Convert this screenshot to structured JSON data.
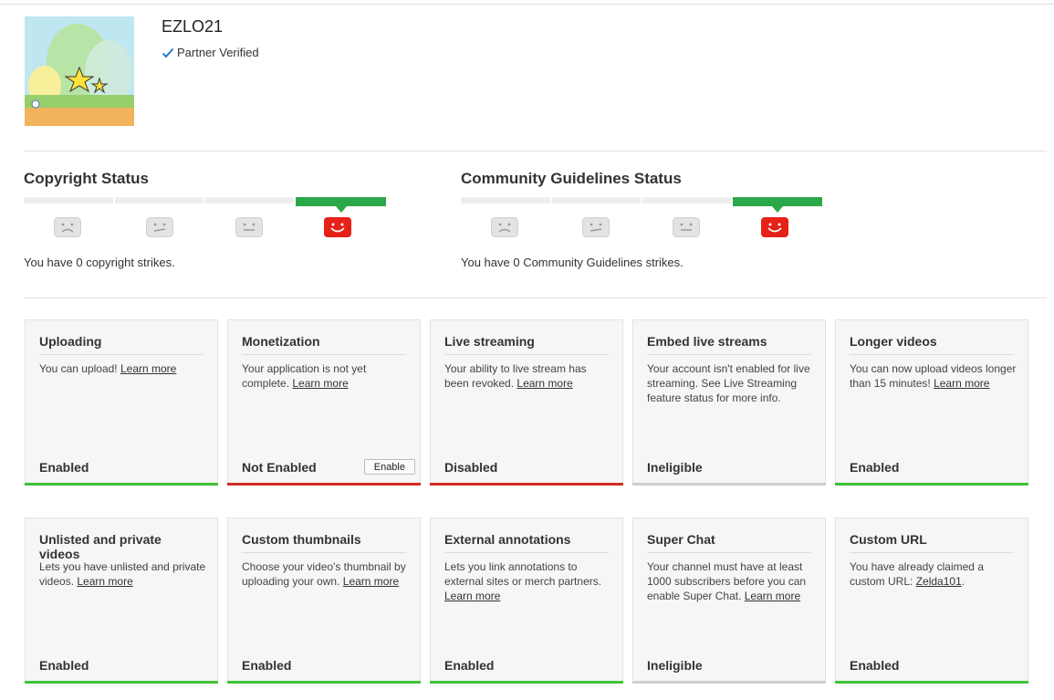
{
  "channel": {
    "name": "EZLO21",
    "verified_label": "Partner Verified"
  },
  "copyright": {
    "title": "Copyright Status",
    "summary": "You have 0 copyright strikes.",
    "active_level": 4
  },
  "community": {
    "title": "Community Guidelines Status",
    "summary": "You have 0 Community Guidelines strikes.",
    "active_level": 4
  },
  "colors": {
    "enabled": "#3fc23a",
    "disabled": "#d22c22",
    "ineligible": "#cfcfcf",
    "meter_active": "#2ba84a",
    "face_active": "#e62117"
  },
  "features": [
    {
      "title": "Uploading",
      "text": "You can upload!",
      "link": "Learn more",
      "text_after": "",
      "state": "Enabled",
      "status": "green"
    },
    {
      "title": "Monetization",
      "text": "Your application is not yet complete.",
      "link": "Learn more",
      "text_after": "",
      "state": "Not Enabled",
      "status": "red",
      "button": "Enable"
    },
    {
      "title": "Live streaming",
      "text": "Your ability to live stream has been revoked.",
      "link": "Learn more",
      "text_after": "",
      "state": "Disabled",
      "status": "red"
    },
    {
      "title": "Embed live streams",
      "text": "Your account isn't enabled for live streaming. See Live Streaming feature status for more info.",
      "link": "",
      "text_after": "",
      "state": "Ineligible",
      "status": "gray"
    },
    {
      "title": "Longer videos",
      "text": "You can now upload videos longer than 15 minutes!",
      "link": "Learn more",
      "text_after": "",
      "state": "Enabled",
      "status": "green"
    },
    {
      "title": "Unlisted and private videos",
      "text": "Lets you have unlisted and private videos.",
      "link": "Learn more",
      "text_after": "",
      "state": "Enabled",
      "status": "green"
    },
    {
      "title": "Custom thumbnails",
      "text": "Choose your video's thumbnail by uploading your own.",
      "link": "Learn more",
      "text_after": "",
      "state": "Enabled",
      "status": "green"
    },
    {
      "title": "External annotations",
      "text": "Lets you link annotations to external sites or merch partners.",
      "link": "Learn more",
      "text_after": "",
      "state": "Enabled",
      "status": "green"
    },
    {
      "title": "Super Chat",
      "text": "Your channel must have at least 1000 subscribers before you can enable Super Chat.",
      "link": "Learn more",
      "text_after": "",
      "state": "Ineligible",
      "status": "gray"
    },
    {
      "title": "Custom URL",
      "text": "You have already claimed a custom URL:",
      "link": "Zelda101",
      "text_after": ".",
      "state": "Enabled",
      "status": "green"
    }
  ]
}
